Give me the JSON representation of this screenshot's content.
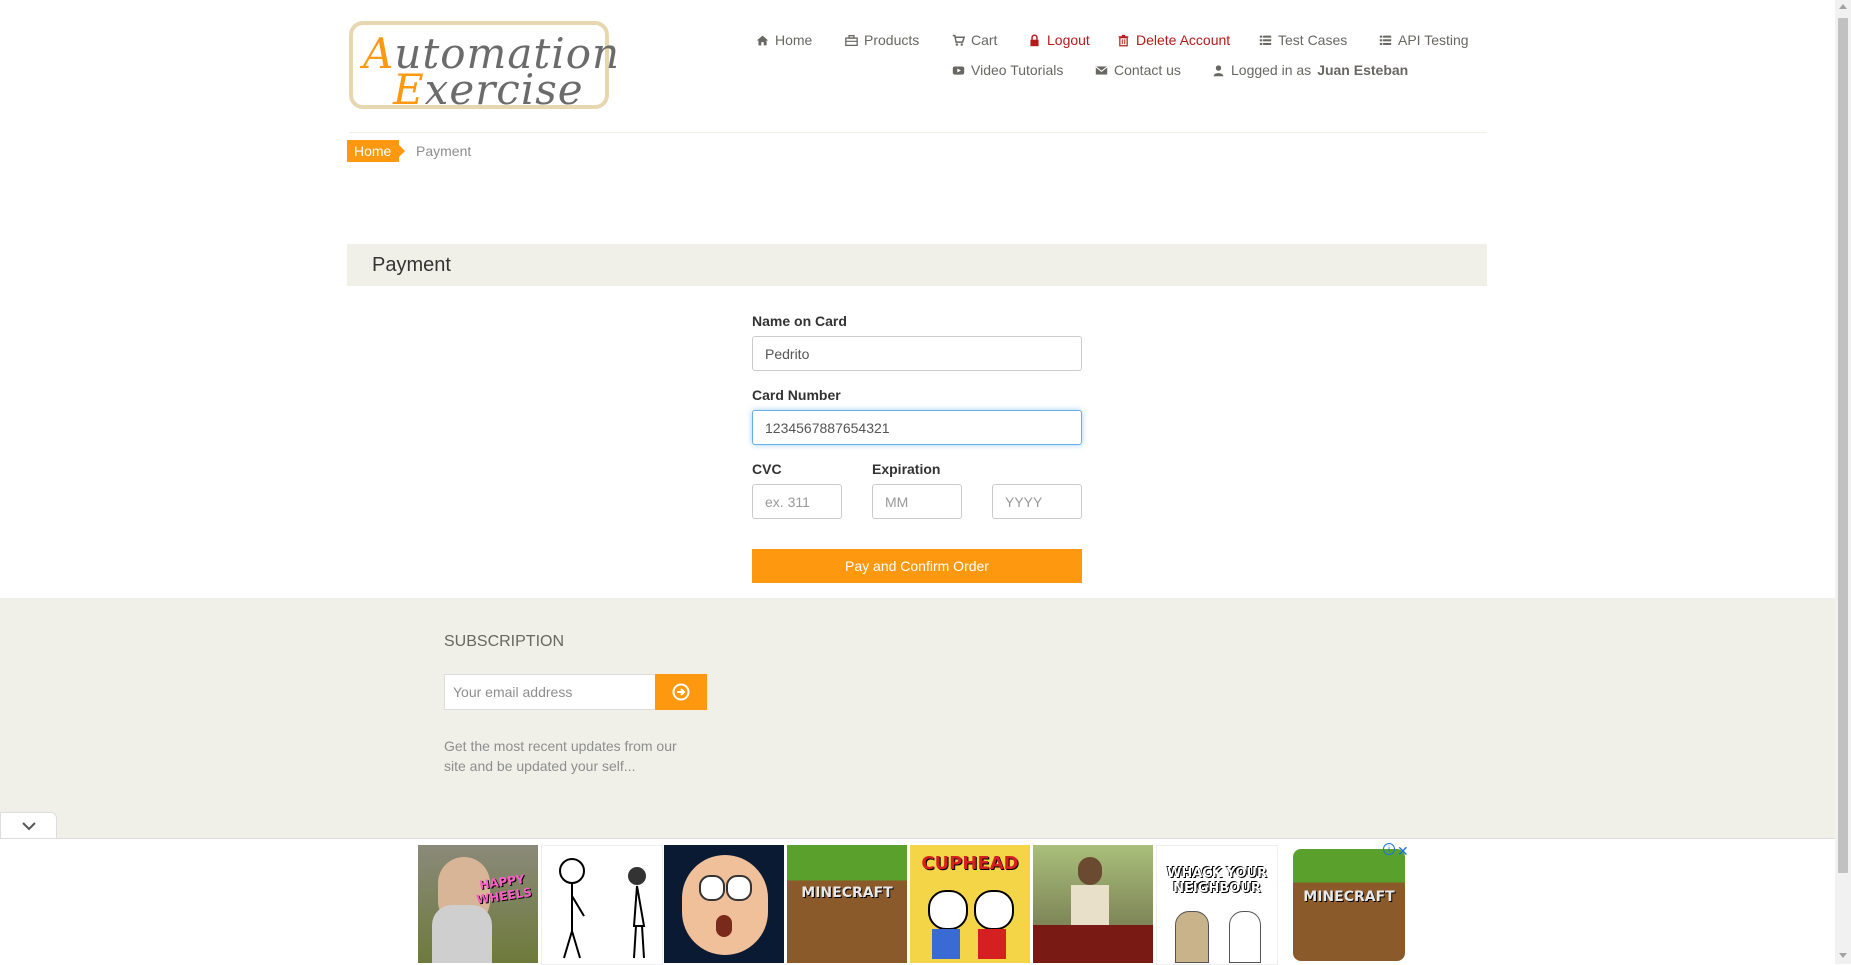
{
  "logo": {
    "line1_cap": "A",
    "line1_rest": "utomation",
    "line2_cap": "E",
    "line2_rest": "xercise"
  },
  "nav": {
    "home": "Home",
    "products": "Products",
    "cart": "Cart",
    "logout": "Logout",
    "delete_account": "Delete Account",
    "test_cases": "Test Cases",
    "api_testing": "API Testing",
    "video_tutorials": "Video Tutorials",
    "contact_us": "Contact us",
    "logged_in_prefix": "Logged in as",
    "logged_in_user": "Juan Esteban"
  },
  "breadcrumb": {
    "home": "Home",
    "current": "Payment"
  },
  "payment": {
    "heading": "Payment",
    "name_label": "Name on Card",
    "name_value": "Pedrito",
    "card_label": "Card Number",
    "card_value": "1234567887654321",
    "cvc_label": "CVC",
    "cvc_placeholder": "ex. 311",
    "expiration_label": "Expiration",
    "month_placeholder": "MM",
    "year_placeholder": "YYYY",
    "submit_label": "Pay and Confirm Order"
  },
  "footer": {
    "subscription_title": "SUBSCRIPTION",
    "email_placeholder": "Your email address",
    "description": "Get the most recent updates from our site and be updated your self..."
  },
  "ads": {
    "tiles": [
      "HAPPY WHEELS",
      "",
      "",
      "MINECRAFT",
      "CUPHEAD",
      "",
      "WHACK YOUR NEIGHBOUR",
      "MINECRAFT"
    ],
    "close": "✕"
  },
  "colors": {
    "accent": "#fe980f",
    "footer_bg": "#f0f0e9",
    "danger": "#b41a1a"
  }
}
